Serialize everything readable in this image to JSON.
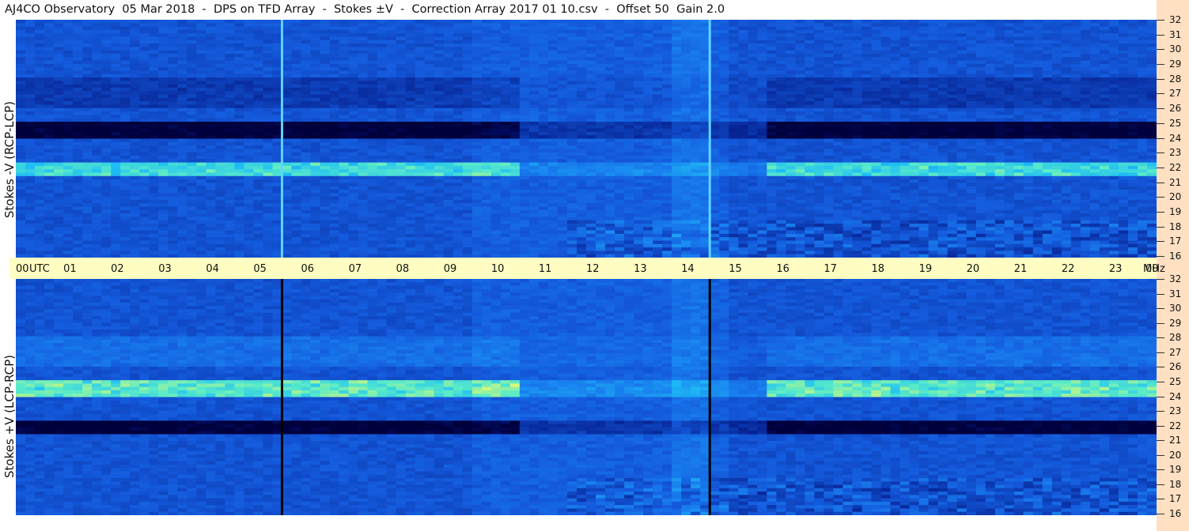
{
  "chart_data": {
    "type": "heatmap",
    "title": "AJ4CO Observatory  05 Mar 2018  -  DPS on TFD Array  -  Stokes ±V  -  Correction Array 2017 01 10.csv  -  Offset 50  Gain 2.0",
    "x_ticks": [
      "00",
      "01",
      "02",
      "03",
      "04",
      "05",
      "06",
      "07",
      "08",
      "09",
      "10",
      "11",
      "12",
      "13",
      "14",
      "15",
      "16",
      "17",
      "18",
      "19",
      "20",
      "21",
      "22",
      "23",
      "00"
    ],
    "x_unit_label": "UTC",
    "y_unit_label": "MHz",
    "y_ticks": [
      32,
      31,
      30,
      29,
      28,
      27,
      26,
      25,
      24,
      23,
      22,
      21,
      20,
      19,
      18,
      17,
      16
    ],
    "ylim": [
      16,
      32
    ],
    "xlim": [
      0,
      24
    ],
    "panels": [
      {
        "name": "Stokes -V (RCP-LCP)",
        "ylabel": "Stokes -V (RCP-LCP)",
        "bands": [
          {
            "freq": [
              24,
              25.2
            ],
            "level": -0.9
          },
          {
            "freq": [
              21.4,
              22.4
            ],
            "level": 0.8
          },
          {
            "freq": [
              26,
              28
            ],
            "level": -0.2
          }
        ],
        "vertical_lines_utc": [
          5.6,
          14.6
        ],
        "vertical_line_color": "#5fd3ff"
      },
      {
        "name": "Stokes +V (LCP-RCP)",
        "ylabel": "Stokes +V (LCP-RCP)",
        "bands": [
          {
            "freq": [
              24,
              25.2
            ],
            "level": 0.9
          },
          {
            "freq": [
              21.4,
              22.4
            ],
            "level": -0.9
          },
          {
            "freq": [
              26,
              28
            ],
            "level": 0.2
          }
        ],
        "vertical_lines_utc": [
          5.6,
          14.6
        ],
        "vertical_line_color": "#000000"
      }
    ]
  }
}
